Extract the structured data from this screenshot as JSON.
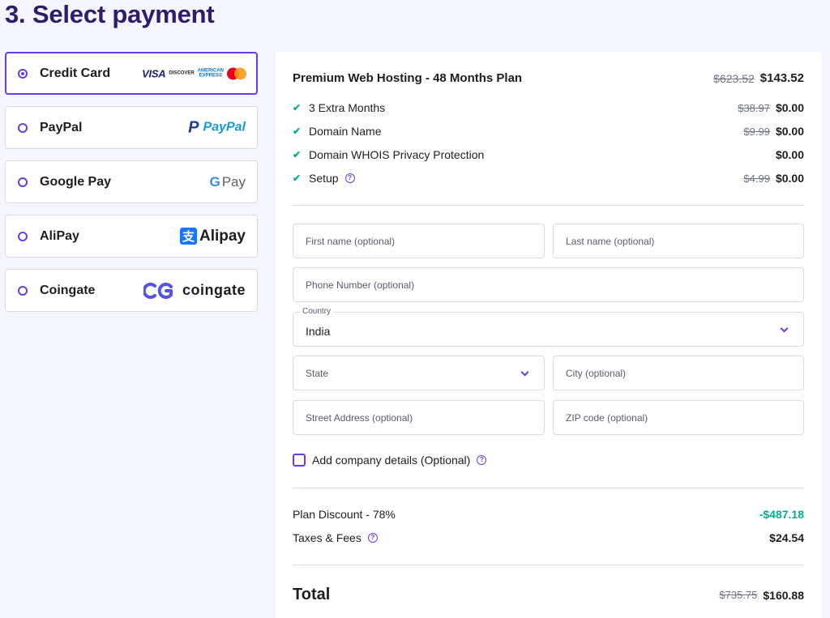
{
  "page": {
    "title": "3. Select payment"
  },
  "payment_methods": [
    {
      "label": "Credit Card",
      "selected": true,
      "logo": "visa-discover-amex-mastercard"
    },
    {
      "label": "PayPal",
      "selected": false,
      "logo": "paypal"
    },
    {
      "label": "Google Pay",
      "selected": false,
      "logo": "google-pay"
    },
    {
      "label": "AliPay",
      "selected": false,
      "logo": "alipay"
    },
    {
      "label": "Coingate",
      "selected": false,
      "logo": "coingate"
    }
  ],
  "logos": {
    "visa": "VISA",
    "discover": "DISCOVER",
    "amex_top": "AMERICAN",
    "amex_bottom": "EXPRESS",
    "paypal": "PayPal",
    "gpay_g": "G",
    "gpay_pay": "Pay",
    "alipay": "Alipay",
    "alipay_glyph": "支",
    "coingate": "coingate"
  },
  "order": {
    "plan": {
      "name": "Premium Web Hosting - 48 Months Plan",
      "old_price": "$623.52",
      "price": "$143.52"
    },
    "items": [
      {
        "label": "3 Extra Months",
        "old_price": "$38.97",
        "price": "$0.00",
        "help": false
      },
      {
        "label": "Domain Name",
        "old_price": "$9.99",
        "price": "$0.00",
        "help": false
      },
      {
        "label": "Domain WHOIS Privacy Protection",
        "old_price": "",
        "price": "$0.00",
        "help": false
      },
      {
        "label": "Setup",
        "old_price": "$4.99",
        "price": "$0.00",
        "help": true
      }
    ]
  },
  "form": {
    "first_name": {
      "placeholder": "First name (optional)",
      "value": ""
    },
    "last_name": {
      "placeholder": "Last name (optional)",
      "value": ""
    },
    "phone": {
      "placeholder": "Phone Number (optional)",
      "value": ""
    },
    "country": {
      "label": "Country",
      "value": "India"
    },
    "state": {
      "placeholder": "State",
      "value": ""
    },
    "city": {
      "placeholder": "City (optional)",
      "value": ""
    },
    "street": {
      "placeholder": "Street Address (optional)",
      "value": ""
    },
    "zip": {
      "placeholder": "ZIP code (optional)",
      "value": ""
    },
    "company_checkbox": {
      "label": "Add company details (Optional)",
      "checked": false
    }
  },
  "summary": {
    "discount_label": "Plan Discount - 78%",
    "discount_value": "-$487.18",
    "taxes_label": "Taxes & Fees",
    "taxes_value": "$24.54",
    "total_label": "Total",
    "total_old": "$735.75",
    "total_value": "$160.88"
  },
  "colors": {
    "accent": "#673de6",
    "title": "#2f1c6a",
    "success": "#00b090",
    "background": "#f4f5ff"
  }
}
